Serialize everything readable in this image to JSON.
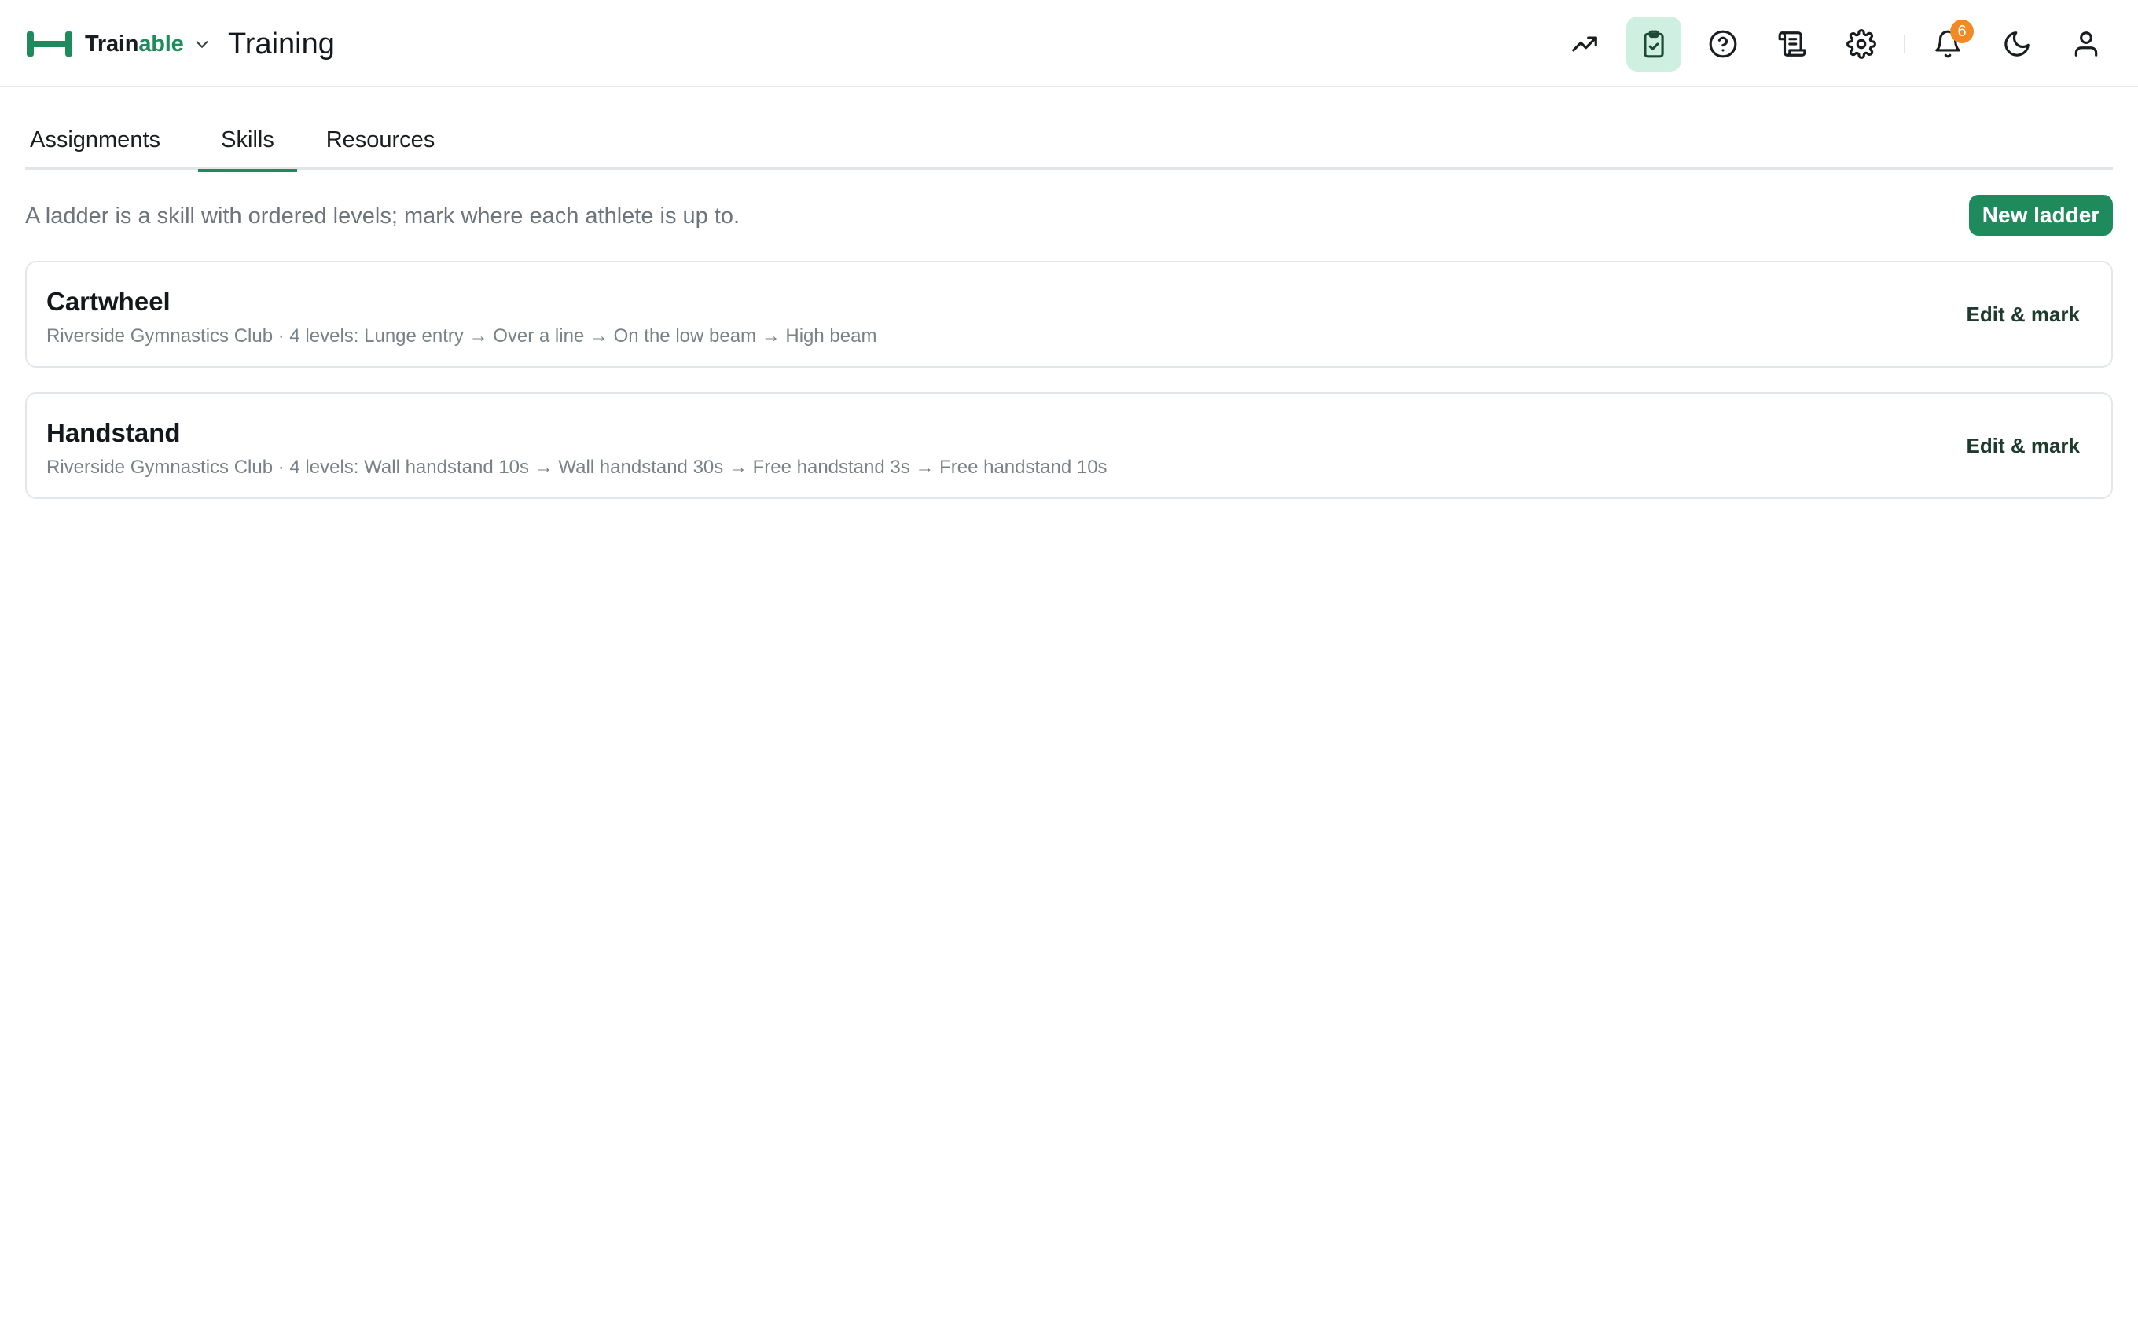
{
  "brand": {
    "name_part_1": "Train",
    "name_part_2": "able",
    "accent_color": "#1f8a5b"
  },
  "header": {
    "page_title": "Training",
    "icons": [
      {
        "name": "trending-up-icon"
      },
      {
        "name": "clipboard-check-icon",
        "active": true
      },
      {
        "name": "help-circle-icon"
      },
      {
        "name": "scroll-icon"
      },
      {
        "name": "settings-gear-icon"
      },
      {
        "name": "bell-icon",
        "badge": "6"
      },
      {
        "name": "moon-icon"
      },
      {
        "name": "user-icon"
      }
    ],
    "notification_count": "6"
  },
  "tabs": [
    {
      "label": "Assignments",
      "active": false
    },
    {
      "label": "Skills",
      "active": true
    },
    {
      "label": "Resources",
      "active": false
    }
  ],
  "skills": {
    "description": "A ladder is a skill with ordered levels; mark where each athlete is up to.",
    "new_button_label": "New ladder",
    "ladders": [
      {
        "title": "Cartwheel",
        "subtitle": "Riverside Gymnastics Club · 4 levels: Lunge entry → Over a line → On the low beam → High beam",
        "action_label": "Edit & mark"
      },
      {
        "title": "Handstand",
        "subtitle": "Riverside Gymnastics Club · 4 levels: Wall handstand 10s → Wall handstand 30s → Free handstand 3s → Free handstand 10s",
        "action_label": "Edit & mark"
      }
    ]
  },
  "colors": {
    "primary": "#1f8a5b",
    "active_icon_bg": "#cfefe0",
    "badge": "#f08a24",
    "muted_text": "#6d747a"
  }
}
